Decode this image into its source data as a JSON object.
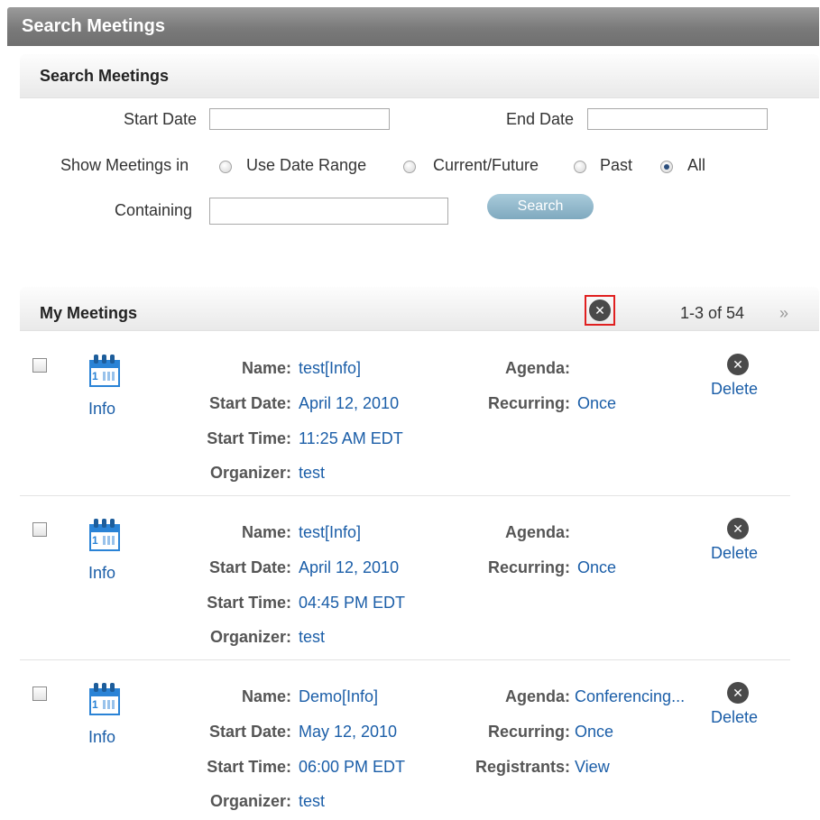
{
  "window": {
    "title": "Search Meetings"
  },
  "search_panel": {
    "header": "Search Meetings",
    "start_date_label": "Start Date",
    "start_date_value": "",
    "end_date_label": "End Date",
    "end_date_value": "",
    "show_label": "Show Meetings in",
    "options": [
      {
        "label": "Use Date Range",
        "checked": false
      },
      {
        "label": "Current/Future",
        "checked": false
      },
      {
        "label": "Past",
        "checked": false
      },
      {
        "label": "All",
        "checked": true
      }
    ],
    "containing_label": "Containing",
    "containing_value": "",
    "search_button": "Search"
  },
  "my_meetings": {
    "header": "My Meetings",
    "clear_icon": "close-circle-icon",
    "pager_text": "1-3 of 54",
    "pager_next": "»",
    "field_labels": {
      "name": "Name:",
      "start_date": "Start Date:",
      "start_time": "Start Time:",
      "organizer": "Organizer:",
      "agenda": "Agenda:",
      "recurring": "Recurring:",
      "registrants": "Registrants:"
    },
    "info_label": "Info",
    "delete_label": "Delete",
    "calendar_day": "1",
    "rows": [
      {
        "name": "test[Info]",
        "start_date": "April 12, 2010",
        "start_time": "11:25 AM EDT",
        "organizer": "test",
        "agenda": "",
        "recurring": "Once"
      },
      {
        "name": "test[Info]",
        "start_date": "April 12, 2010",
        "start_time": "04:45 PM EDT",
        "organizer": "test",
        "agenda": "",
        "recurring": "Once"
      },
      {
        "name": "Demo[Info]",
        "start_date": "May 12, 2010",
        "start_time": "06:00 PM EDT",
        "organizer": "test",
        "agenda": "Conferencing...",
        "recurring": "Once",
        "registrants": "View"
      }
    ]
  },
  "colors": {
    "link": "#1b5ea8",
    "title_bar": "#7a7a7a",
    "highlight": "#e02020"
  }
}
